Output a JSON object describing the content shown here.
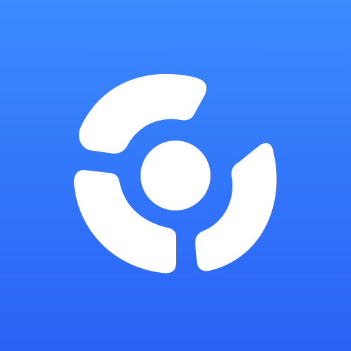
{
  "icon": {
    "name": "logo-icon",
    "description_type": "app-launcher-icon",
    "colors": {
      "background_top": "#3B8BFE",
      "background_bottom": "#2A62F5",
      "glyph": "#FFFFFF"
    }
  }
}
